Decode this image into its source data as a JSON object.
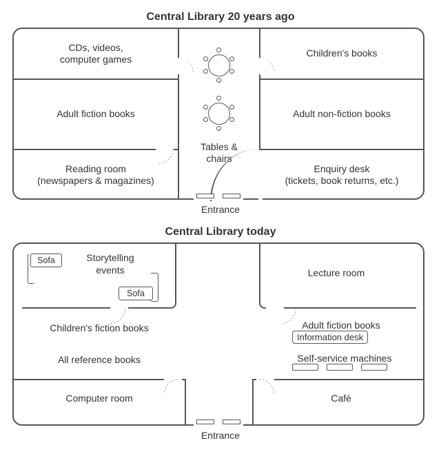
{
  "plan_before": {
    "title": "Central Library 20 years ago",
    "entrance": "Entrance",
    "rooms": {
      "cds": "CDs, videos,\ncomputer games",
      "children": "Children's books",
      "adult_fiction": "Adult fiction books",
      "adult_nonfiction": "Adult non-fiction books",
      "reading": "Reading room\n(newspapers & magazines)",
      "enquiry": "Enquiry desk\n(tickets, book returns, etc.)",
      "tables": "Tables &\nchairs"
    }
  },
  "plan_after": {
    "title": "Central Library today",
    "entrance": "Entrance",
    "rooms": {
      "storytelling": "Storytelling\nevents",
      "lecture": "Lecture room",
      "children_fiction": "Children's fiction books",
      "adult_fiction": "Adult fiction books",
      "all_reference": "All reference books",
      "self_service": "Self-service machines",
      "computer_room": "Computer room",
      "cafe": "Café",
      "info_desk": "Information desk"
    },
    "labels": {
      "sofa": "Sofa"
    }
  }
}
